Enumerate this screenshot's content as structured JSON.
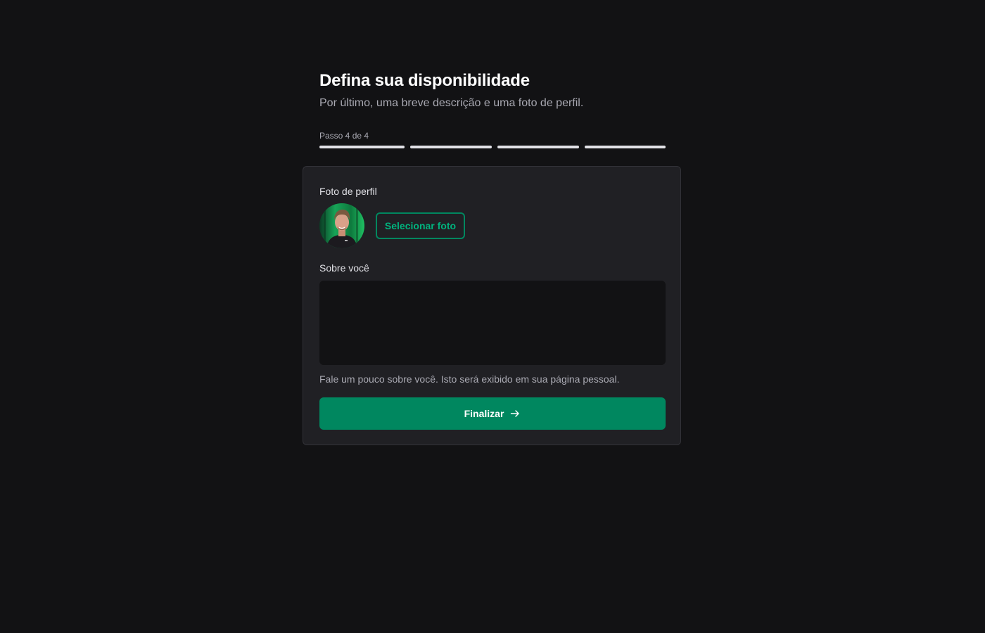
{
  "header": {
    "title": "Defina sua disponibilidade",
    "subtitle": "Por último, uma breve descrição e uma foto de perfil."
  },
  "steps": {
    "label": "Passo 4 de 4",
    "current": 4,
    "total": 4
  },
  "form": {
    "photo_label": "Foto de perfil",
    "select_photo_label": "Selecionar foto",
    "about_label": "Sobre você",
    "about_value": "",
    "about_helper": "Fale um pouco sobre você. Isto será exibido em sua página pessoal.",
    "finish_label": "Finalizar",
    "finish_icon": "arrow-right-icon"
  },
  "colors": {
    "background": "#121214",
    "card": "#202024",
    "accent": "#00875f",
    "accent_text": "#00b37e",
    "step_active": "#e1e1e6"
  }
}
